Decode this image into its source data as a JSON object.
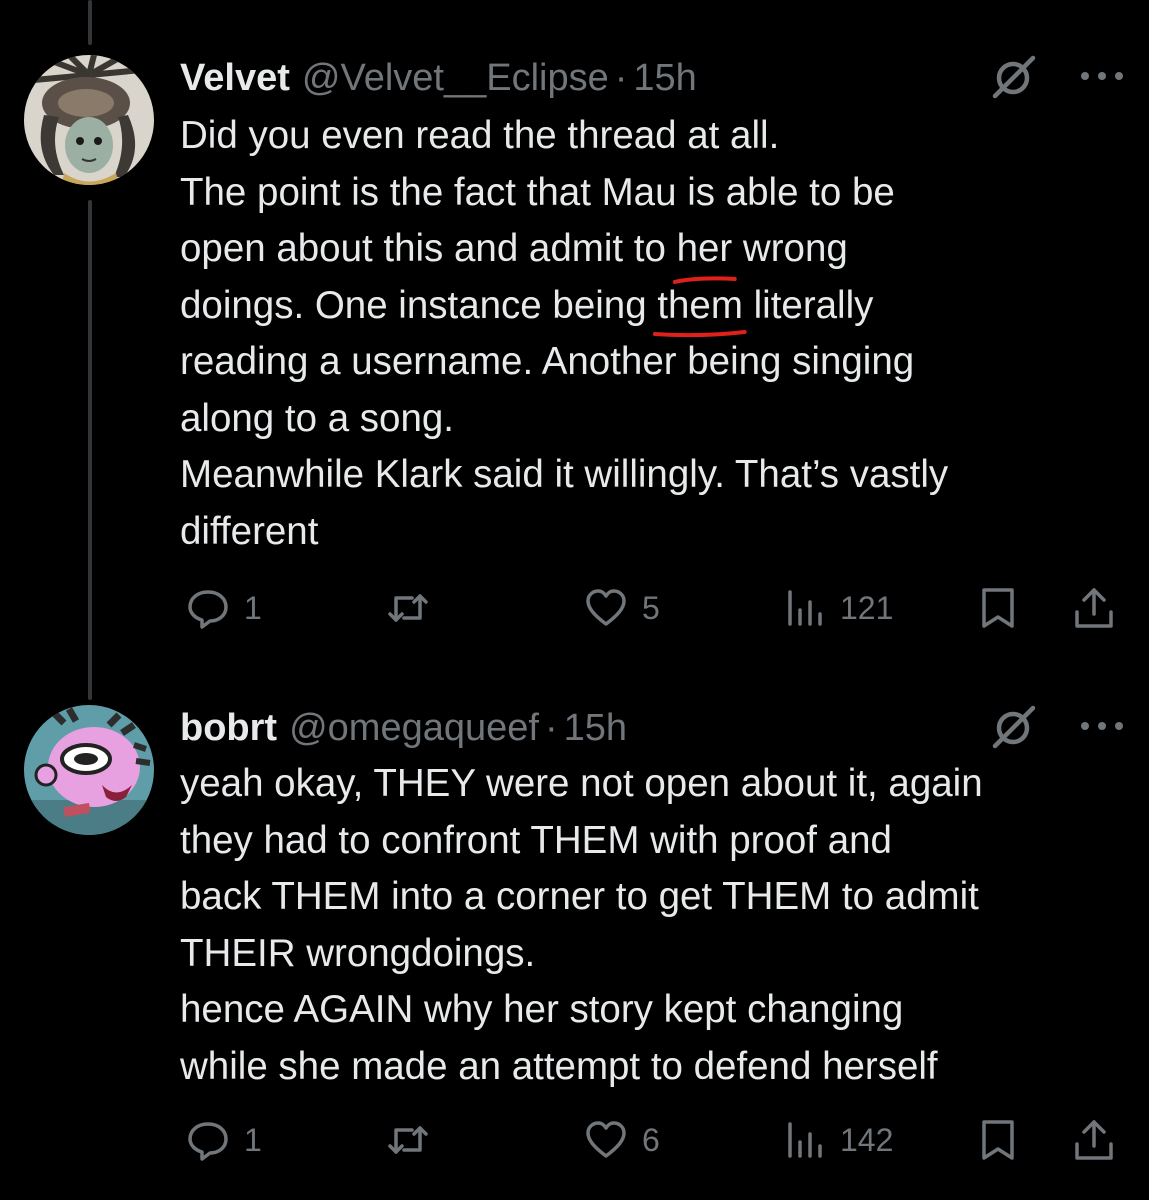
{
  "tweets": [
    {
      "display_name": "Velvet",
      "handle": "@Velvet__Eclipse",
      "separator": "·",
      "time": "15h",
      "lines_before_1": "Did you even read the thread at all.",
      "line_2": "The point is the fact that Mau is able to be",
      "line_3_pre": "open about this and admit to ",
      "line_3_underlined": "her",
      "line_3_post": " wrong",
      "line_4_pre": "doings. One instance being ",
      "line_4_underlined": "them",
      "line_4_post": " literally",
      "line_5": "reading a username. Another being singing",
      "line_6": "along to a song.",
      "line_7": "Meanwhile Klark said it willingly. That’s vastly",
      "line_8": "different",
      "replies": "1",
      "likes": "5",
      "views": "121"
    },
    {
      "display_name": "bobrt",
      "handle": "@omegaqueef",
      "separator": "·",
      "time": "15h",
      "line_1": "yeah okay, THEY were not open about it, again",
      "line_2": "they had to confront THEM with proof and",
      "line_3": "back THEM into a corner to get THEM to admit",
      "line_4": "THEIR wrongdoings.",
      "line_5": "hence AGAIN why her story kept changing",
      "line_6": "while she made an attempt to defend herself",
      "replies": "1",
      "likes": "6",
      "views": "142"
    }
  ],
  "icons": {
    "reply": "reply-icon",
    "retweet": "retweet-icon",
    "like": "heart-icon",
    "views": "views-icon",
    "bookmark": "bookmark-icon",
    "share": "share-icon",
    "grok": "grok-icon",
    "more": "more-icon"
  },
  "colors": {
    "background": "#000000",
    "text": "#e7e9ea",
    "muted": "#71767b",
    "thread_line": "#333639",
    "annotation_underline": "#e0201b"
  }
}
